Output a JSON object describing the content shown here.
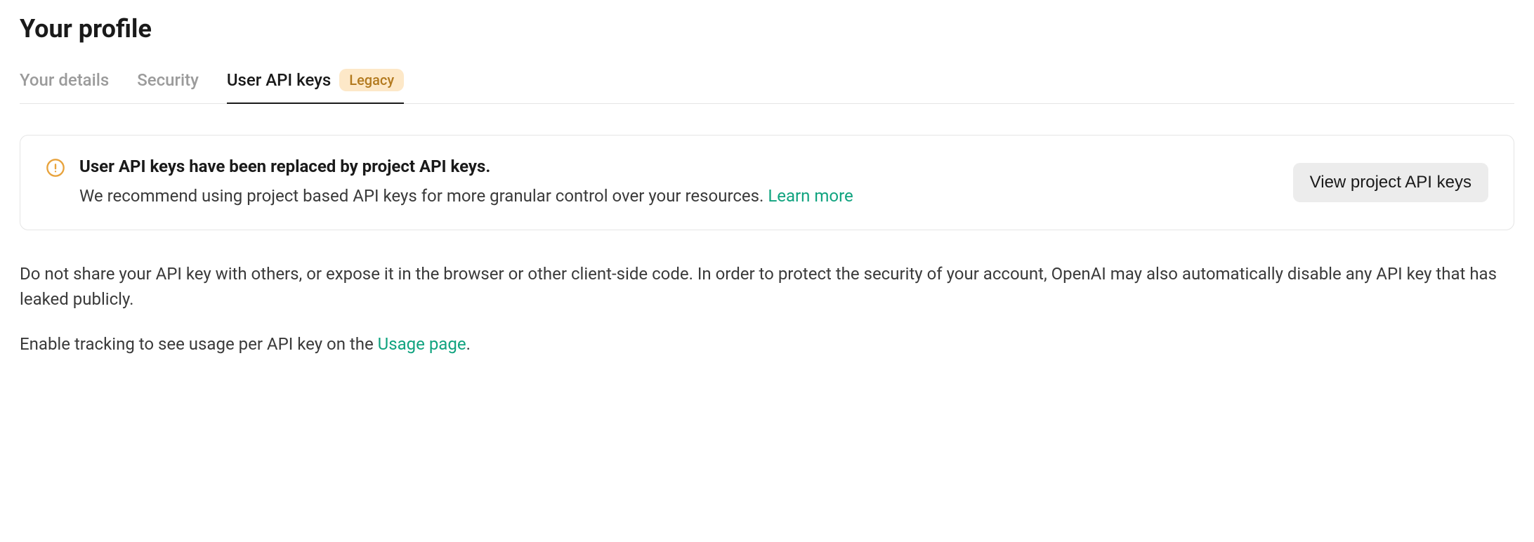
{
  "page": {
    "title": "Your profile"
  },
  "tabs": {
    "details": "Your details",
    "security": "Security",
    "apikeys": "User API keys",
    "apikeys_badge": "Legacy"
  },
  "alert": {
    "title": "User API keys have been replaced by project API keys.",
    "desc_prefix": "We recommend using project based API keys for more granular control over your resources. ",
    "learn_more": "Learn more",
    "button": "View project API keys"
  },
  "body": {
    "para1": "Do not share your API key with others, or expose it in the browser or other client-side code. In order to protect the security of your account, OpenAI may also automatically disable any API key that has leaked publicly.",
    "para2_prefix": "Enable tracking to see usage per API key on the ",
    "para2_link": "Usage page",
    "para2_suffix": "."
  }
}
